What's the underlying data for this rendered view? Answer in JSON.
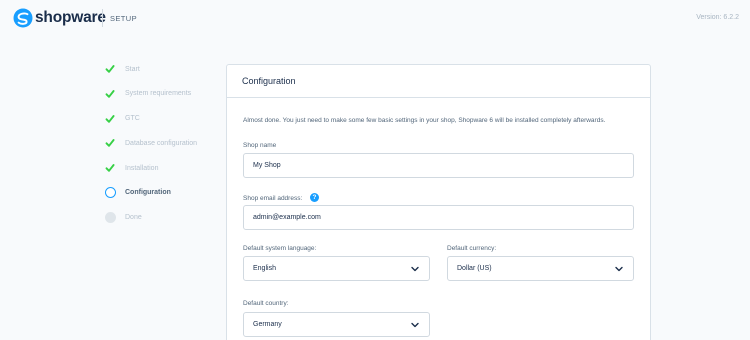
{
  "header": {
    "logo_text": "shopware",
    "setup_label": "SETUP",
    "version": "Version: 6.2.2"
  },
  "steps": [
    {
      "label": "Start",
      "status": "done"
    },
    {
      "label": "System requirements",
      "status": "done"
    },
    {
      "label": "GTC",
      "status": "done"
    },
    {
      "label": "Database configuration",
      "status": "done"
    },
    {
      "label": "Installation",
      "status": "done"
    },
    {
      "label": "Configuration",
      "status": "active"
    },
    {
      "label": "Done",
      "status": "pending"
    }
  ],
  "config": {
    "title": "Configuration",
    "intro": "Almost done. You just need to make some few basic settings in your shop, Shopware 6 will be installed completely afterwards.",
    "shop_name": {
      "label": "Shop name",
      "value": "My Shop"
    },
    "shop_email": {
      "label": "Shop email address:",
      "value": "admin@example.com",
      "help_icon": "?"
    },
    "language": {
      "label": "Default system language:",
      "value": "English"
    },
    "currency": {
      "label": "Default currency:",
      "value": "Dollar (US)"
    },
    "country": {
      "label": "Default country:",
      "value": "Germany"
    }
  },
  "colors": {
    "accent": "#189eff",
    "check": "#37d046",
    "text_dark": "#1a2d4a",
    "text_muted": "#b5c1cd"
  }
}
